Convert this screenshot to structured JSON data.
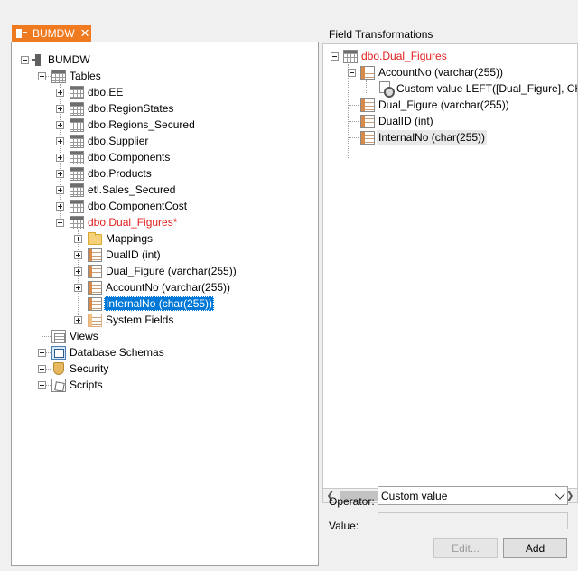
{
  "tab": {
    "label": "BUMDW",
    "close_glyph": "✕",
    "accent": "#f07a20"
  },
  "left_tree": {
    "root": "BUMDW",
    "tables_label": "Tables",
    "tables": [
      "dbo.EE",
      "dbo.RegionStates",
      "dbo.Regions_Secured",
      "dbo.Supplier",
      "dbo.Components",
      "dbo.Products",
      "etl.Sales_Secured",
      "dbo.ComponentCost",
      "dbo.Dual_Figures*"
    ],
    "dual_children": [
      "Mappings",
      "DualID (int)",
      "Dual_Figure (varchar(255))",
      "AccountNo (varchar(255))",
      "InternalNo (char(255))",
      "System Fields"
    ],
    "views": "Views",
    "schemas": "Database Schemas",
    "security": "Security",
    "scripts": "Scripts",
    "modified_color": "#e0201e",
    "selection_color": "#0078d7"
  },
  "field_transformations": {
    "title": "Field Transformations",
    "root": "dbo.Dual_Figures",
    "account": "AccountNo (varchar(255))",
    "custom_value": "Custom value LEFT([Dual_Figure], CHAR",
    "others": [
      "Dual_Figure (varchar(255))",
      "DualID (int)",
      "InternalNo (char(255))"
    ]
  },
  "form": {
    "operator_label": "Operator:",
    "operator_value": "Custom value",
    "value_label": "Value:",
    "value": "",
    "edit_label": "Edit...",
    "add_label": "Add"
  }
}
